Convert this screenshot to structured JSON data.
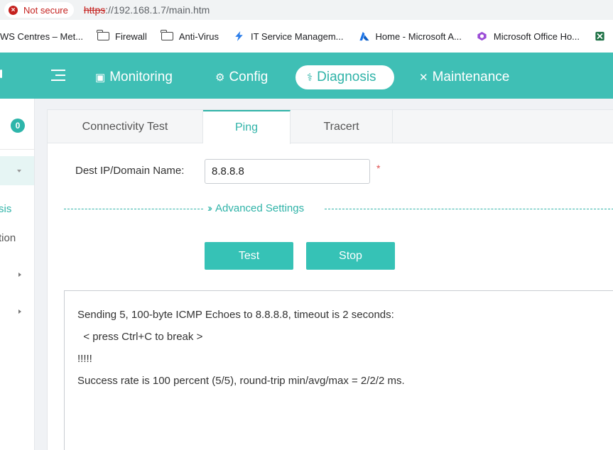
{
  "address_bar": {
    "security_label": "Not secure",
    "url_scheme": "https",
    "url_rest": "://192.168.1.7/main.htm"
  },
  "bookmarks": [
    {
      "label": "WS Centres – Met...",
      "icon": "none"
    },
    {
      "label": "Firewall",
      "icon": "folder-icon"
    },
    {
      "label": "Anti-Virus",
      "icon": "folder-icon"
    },
    {
      "label": "IT Service Managem...",
      "icon": "lightning-icon"
    },
    {
      "label": "Home - Microsoft A...",
      "icon": "azure-icon"
    },
    {
      "label": "Microsoft Office Ho...",
      "icon": "office-icon"
    }
  ],
  "nav": {
    "monitoring": "Monitoring",
    "config": "Config",
    "diagnosis": "Diagnosis",
    "maintenance": "Maintenance"
  },
  "sidebar": {
    "badge": "0",
    "item_partial_1": "sis",
    "item_partial_2": "tion"
  },
  "tabs": {
    "connectivity": "Connectivity Test",
    "ping": "Ping",
    "tracert": "Tracert"
  },
  "form": {
    "dest_label": "Dest IP/Domain Name:",
    "dest_value": "8.8.8.8",
    "required_mark": "*",
    "advanced": "Advanced Settings",
    "test_button": "Test",
    "stop_button": "Stop"
  },
  "output": {
    "lines": [
      "Sending 5, 100-byte ICMP Echoes to 8.8.8.8, timeout is 2 seconds:",
      "  < press Ctrl+C to break >",
      "!!!!!",
      "Success rate is 100 percent (5/5), round-trip min/avg/max = 2/2/2 ms."
    ]
  },
  "colors": {
    "accent": "#3fbfb5",
    "button": "#36c2b6",
    "warning": "#c5221f"
  }
}
